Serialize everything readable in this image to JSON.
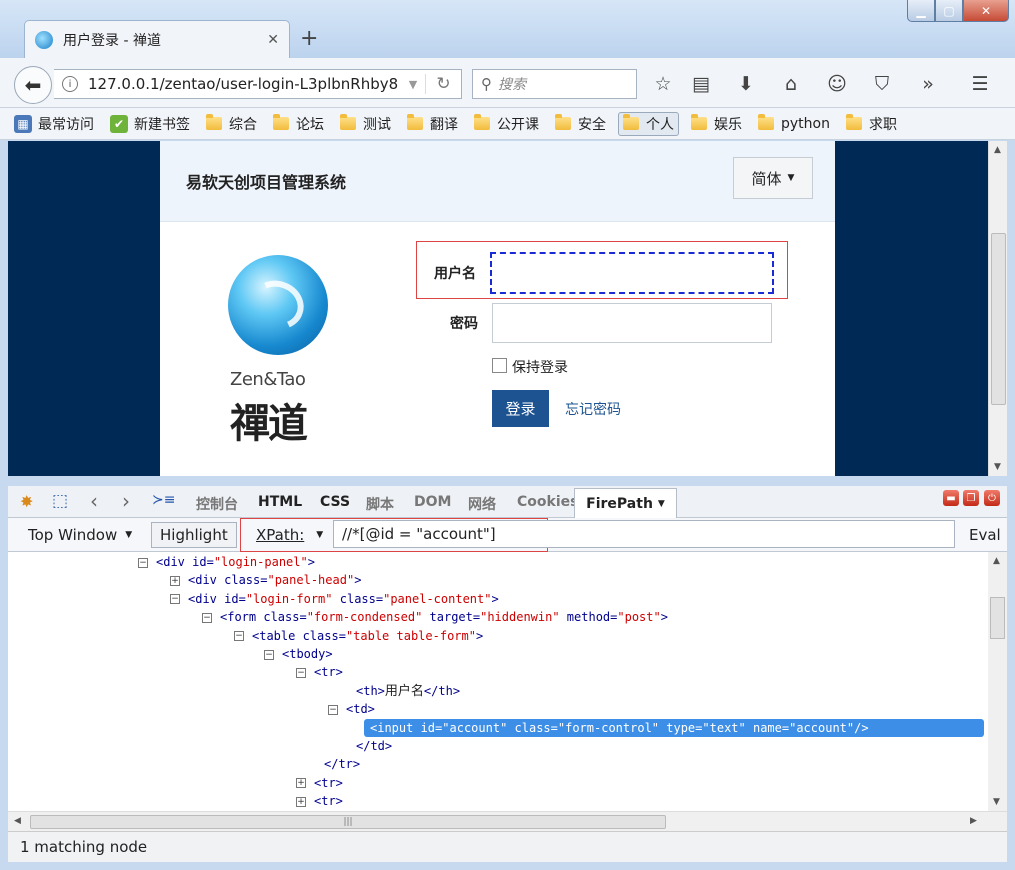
{
  "browser": {
    "tab_title": "用户登录 - 禅道",
    "url": "127.0.0.1/zentao/user-login-L3plbnRhby8",
    "search_placeholder": "搜索"
  },
  "bookmarks": [
    "最常访问",
    "新建书签",
    "综合",
    "论坛",
    "测试",
    "翻译",
    "公开课",
    "安全",
    "个人",
    "娱乐",
    "python",
    "求职"
  ],
  "page": {
    "system_title": "易软天创项目管理系统",
    "language": "简体",
    "logo_en": "Zen&Tao",
    "logo_cn": "禪道",
    "username_label": "用户名",
    "password_label": "密码",
    "remember_label": "保持登录",
    "login_button": "登录",
    "forgot_link": "忘记密码"
  },
  "firebug": {
    "tabs": [
      "控制台",
      "HTML",
      "CSS",
      "脚本",
      "DOM",
      "网络",
      "Cookies",
      "FirePath"
    ],
    "active_tab": "FirePath",
    "top_window": "Top Window",
    "highlight": "Highlight",
    "xpath_label": "XPath:",
    "xpath_value": "//*[@id = \"account\"]",
    "eval": "Eval",
    "status": "1 matching node"
  },
  "tree": [
    {
      "toggle": "−",
      "tag": "<div",
      "attrs": [
        [
          "id",
          "login-panel"
        ]
      ],
      "end": ">"
    },
    {
      "toggle": "+",
      "tag": "<div",
      "attrs": [
        [
          "class",
          "panel-head"
        ]
      ],
      "end": ">"
    },
    {
      "toggle": "−",
      "tag": "<div",
      "attrs": [
        [
          "id",
          "login-form"
        ],
        [
          "class",
          "panel-content"
        ]
      ],
      "end": ">"
    },
    {
      "toggle": "−",
      "tag": "<form",
      "attrs": [
        [
          "class",
          "form-condensed"
        ],
        [
          "target",
          "hiddenwin"
        ],
        [
          "method",
          "post"
        ]
      ],
      "end": ">"
    },
    {
      "toggle": "−",
      "tag": "<table",
      "attrs": [
        [
          "class",
          "table table-form"
        ]
      ],
      "end": ">"
    },
    {
      "toggle": "−",
      "tag": "<tbody>",
      "attrs": [],
      "end": ""
    },
    {
      "toggle": "−",
      "tag": "<tr>",
      "attrs": [],
      "end": ""
    },
    {
      "toggle": "",
      "tag": "<th>",
      "text": "用户名",
      "close": "</th>",
      "attrs": [],
      "end": ""
    },
    {
      "toggle": "−",
      "tag": "<td>",
      "attrs": [],
      "end": ""
    },
    {
      "toggle": "",
      "tag": "<input",
      "attrs": [
        [
          "id",
          "account"
        ],
        [
          "class",
          "form-control"
        ],
        [
          "type",
          "text"
        ],
        [
          "name",
          "account"
        ]
      ],
      "end": "/>",
      "selected": true
    },
    {
      "toggle": "",
      "tag": "</td>",
      "attrs": [],
      "end": ""
    },
    {
      "toggle": "",
      "tag": "</tr>",
      "attrs": [],
      "end": ""
    },
    {
      "toggle": "+",
      "tag": "<tr>",
      "attrs": [],
      "end": ""
    },
    {
      "toggle": "+",
      "tag": "<tr>",
      "attrs": [],
      "end": ""
    }
  ]
}
